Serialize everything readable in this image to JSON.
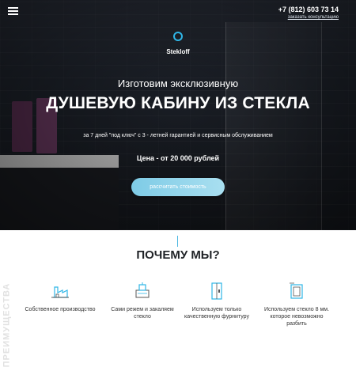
{
  "header": {
    "phone": "+7 (812) 603 73 14",
    "consult_link": "заказать консультацию"
  },
  "logo": {
    "name": "Stekloff"
  },
  "hero": {
    "subtitle": "Изготовим эксклюзивную",
    "title": "ДУШЕВУЮ КАБИНУ ИЗ СТЕКЛА",
    "description": "за 7 дней \"под ключ\" с 3 - летней гарантией и сервисным обслуживанием",
    "price": "Цена - от 20 000 рублей",
    "cta": "рассчитать стоимость"
  },
  "section": {
    "title": "ПОЧЕМУ МЫ?",
    "side_label": "ПРЕИМУЩЕСТВА"
  },
  "features": [
    {
      "label": "Собственное производство",
      "icon": "factory-icon"
    },
    {
      "label": "Сами режем и закаляем стекло",
      "icon": "glass-cutting-icon"
    },
    {
      "label": "Используем только качественную фурнитуру",
      "icon": "door-hardware-icon"
    },
    {
      "label": "Используем стекло 8 мм. которое невозможно разбить",
      "icon": "glass-thickness-icon"
    }
  ],
  "colors": {
    "accent": "#4ab6e1",
    "dark": "#1f242d",
    "button": "#8fd2ea"
  }
}
